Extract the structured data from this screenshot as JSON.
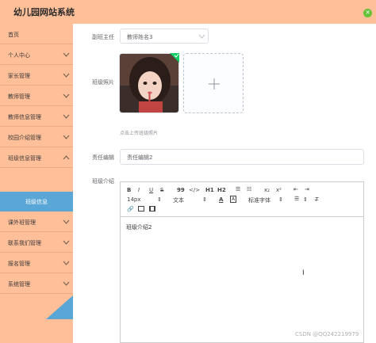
{
  "app": {
    "title": "幼儿园网站系统"
  },
  "sidebar": {
    "items": [
      {
        "label": "首页",
        "chevron": false
      },
      {
        "label": "个人中心",
        "chevron": true
      },
      {
        "label": "家长管理",
        "chevron": true
      },
      {
        "label": "教师管理",
        "chevron": true
      },
      {
        "label": "教师信息管理",
        "chevron": true
      },
      {
        "label": "校园介绍管理",
        "chevron": true
      },
      {
        "label": "班级信息管理",
        "chevron": true
      },
      {
        "label": "课外班管理",
        "chevron": true
      },
      {
        "label": "联系我们管理",
        "chevron": true
      },
      {
        "label": "报名管理",
        "chevron": true
      },
      {
        "label": "系统管理",
        "chevron": true
      }
    ],
    "active_sub": "班级信息"
  },
  "form": {
    "deputy_teacher": {
      "label": "副班主任",
      "value": "教师姓名3"
    },
    "photo": {
      "label": "班级照片",
      "hint": "点击上传班级照片"
    },
    "editor_field": {
      "label": "责任编辑",
      "value": "责任编辑2"
    },
    "intro": {
      "label": "班级介绍",
      "content": "班级介绍2"
    }
  },
  "editor_toolbar": {
    "row1": [
      "B",
      "I",
      "U",
      "S",
      "99",
      "</>",
      "H1",
      "H2",
      "☰",
      "☷",
      "x₂",
      "x²",
      "⇤",
      "⇥"
    ],
    "font_size": "14px",
    "block": "文本",
    "font_family": "标准字体"
  },
  "watermark": "CSDN @QQ242219979",
  "colors": {
    "sidebar": "#ffbf98",
    "active": "#5aa6d6"
  }
}
